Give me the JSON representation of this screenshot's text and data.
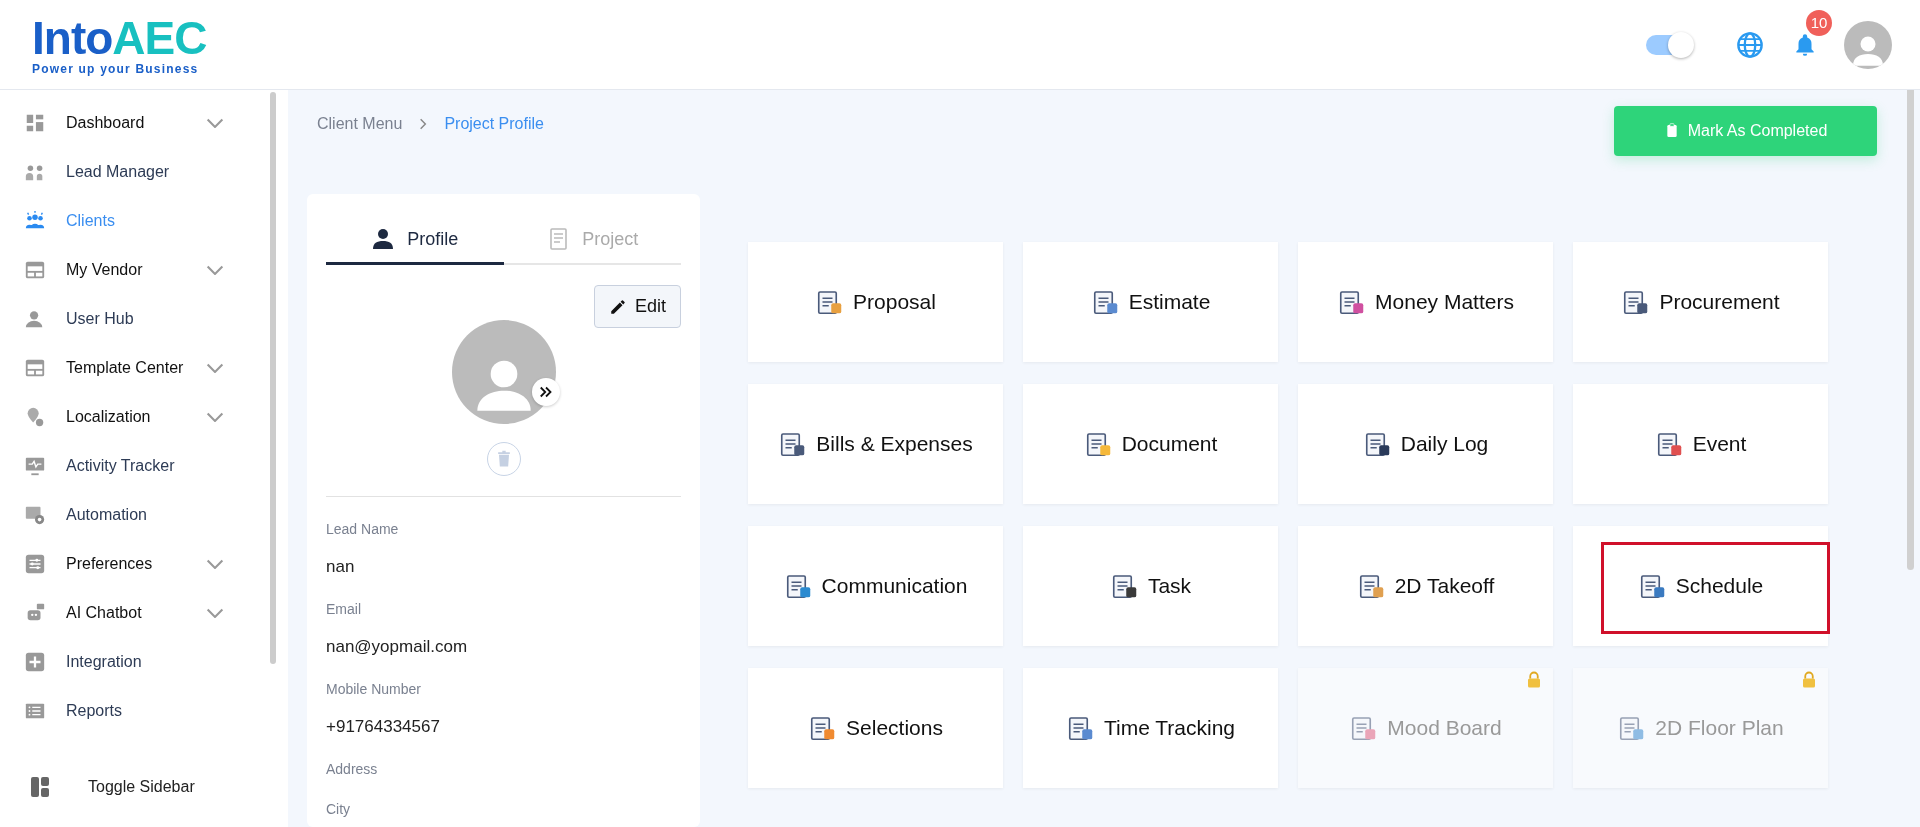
{
  "logo": {
    "wordmark_main": "Into",
    "wordmark_accent": "AEC",
    "tagline": "Power up your Business"
  },
  "header": {
    "theme_toggle": {
      "on": true
    },
    "notification_count": "10"
  },
  "sidebar": {
    "items": [
      {
        "label": "Dashboard",
        "kind": "group",
        "selected": false
      },
      {
        "label": "Lead Manager",
        "kind": "link",
        "selected": false
      },
      {
        "label": "Clients",
        "kind": "link",
        "selected": true
      },
      {
        "label": "My Vendor",
        "kind": "group",
        "selected": false
      },
      {
        "label": "User Hub",
        "kind": "link",
        "selected": false
      },
      {
        "label": "Template Center",
        "kind": "group",
        "selected": false
      },
      {
        "label": "Localization",
        "kind": "group",
        "selected": false
      },
      {
        "label": "Activity Tracker",
        "kind": "link",
        "selected": false
      },
      {
        "label": "Automation",
        "kind": "link",
        "selected": false
      },
      {
        "label": "Preferences",
        "kind": "group",
        "selected": false
      },
      {
        "label": "AI Chatbot",
        "kind": "group",
        "selected": false
      },
      {
        "label": "Integration",
        "kind": "link",
        "selected": false
      },
      {
        "label": "Reports",
        "kind": "link",
        "selected": false
      }
    ],
    "toggle": "Toggle Sidebar"
  },
  "breadcrumb": [
    {
      "label": "Client Menu",
      "current": false
    },
    {
      "label": "Project Profile",
      "current": true
    }
  ],
  "mark_button": "Mark As Completed",
  "profile_card": {
    "tabs": [
      {
        "label": "Profile",
        "selected": true
      },
      {
        "label": "Project",
        "selected": false
      }
    ],
    "edit_button": "Edit",
    "fields": [
      {
        "label": "Lead Name",
        "value": "nan"
      },
      {
        "label": "Email",
        "value": "nan@yopmail.com"
      },
      {
        "label": "Mobile Number",
        "value": "+91764334567"
      },
      {
        "label": "Address"
      },
      {
        "label": "City"
      }
    ]
  },
  "tiles": [
    {
      "label": "Proposal",
      "locked": false,
      "highlighted": false
    },
    {
      "label": "Estimate",
      "locked": false,
      "highlighted": false
    },
    {
      "label": "Money Matters",
      "locked": false,
      "highlighted": false
    },
    {
      "label": "Procurement",
      "locked": false,
      "highlighted": false
    },
    {
      "label": "Bills & Expenses",
      "locked": false,
      "highlighted": false
    },
    {
      "label": "Document",
      "locked": false,
      "highlighted": false
    },
    {
      "label": "Daily Log",
      "locked": false,
      "highlighted": false
    },
    {
      "label": "Event",
      "locked": false,
      "highlighted": false
    },
    {
      "label": "Communication",
      "locked": false,
      "highlighted": false
    },
    {
      "label": "Task",
      "locked": false,
      "highlighted": false
    },
    {
      "label": "2D Takeoff",
      "locked": false,
      "highlighted": false
    },
    {
      "label": "Schedule",
      "locked": false,
      "highlighted": true
    },
    {
      "label": "Selections",
      "locked": false,
      "highlighted": false
    },
    {
      "label": "Time Tracking",
      "locked": false,
      "highlighted": false
    },
    {
      "label": "Mood Board",
      "locked": true,
      "highlighted": false
    },
    {
      "label": "2D Floor Plan",
      "locked": true,
      "highlighted": false
    }
  ]
}
